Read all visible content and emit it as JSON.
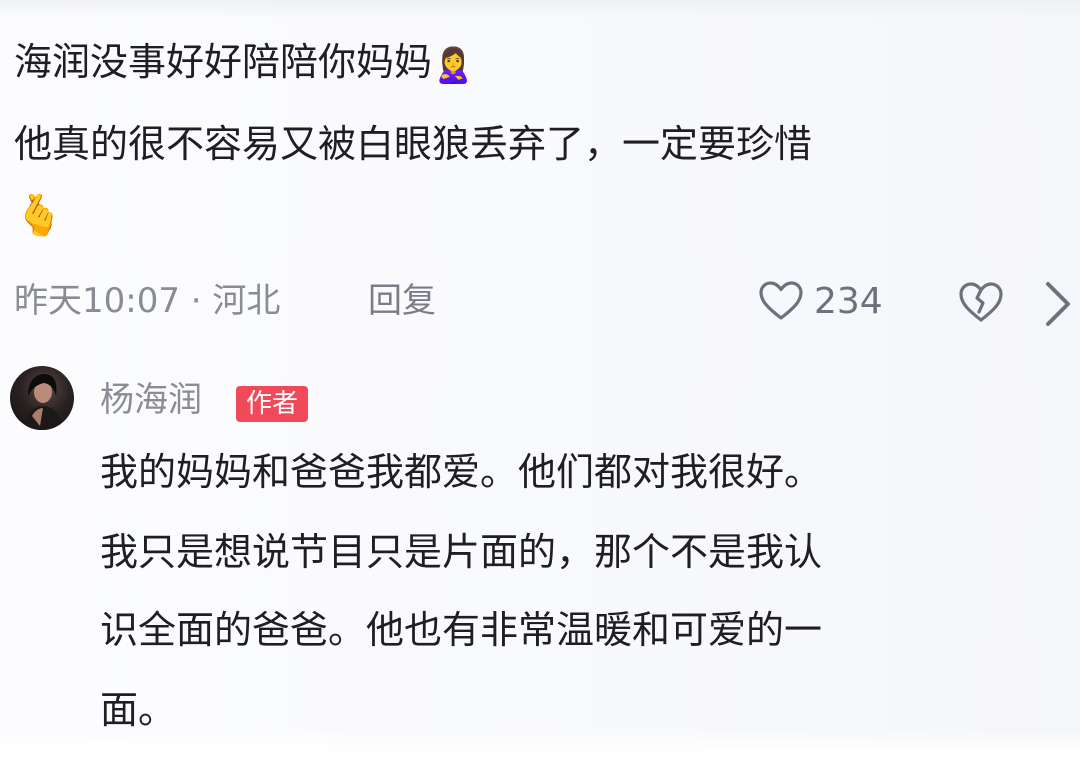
{
  "first_comment": {
    "line1": "海润没事好好陪陪你妈妈",
    "line1_emoji": "🙎‍♀️",
    "line2": "他真的很不容易又被白眼狼丢弃了，一定要珍惜",
    "line3_emoji": "🫰",
    "meta": "昨天10:07 · 河北",
    "reply_label": "回复",
    "like_count": "234",
    "icons": {
      "like": "heart-icon",
      "dislike": "broken-heart-icon",
      "more": "chevron-right-icon"
    }
  },
  "reply": {
    "author_name": "杨海润",
    "author_badge": "作者",
    "lines": [
      "我的妈妈和爸爸我都爱。他们都对我很好。",
      "我只是想说节目只是片面的，那个不是我认",
      "识全面的爸爸。他也有非常温暖和可爱的一",
      "面。"
    ],
    "colors": {
      "badge": "#f04a5a",
      "text": "#1f1f22",
      "muted": "#8a8c94"
    }
  }
}
